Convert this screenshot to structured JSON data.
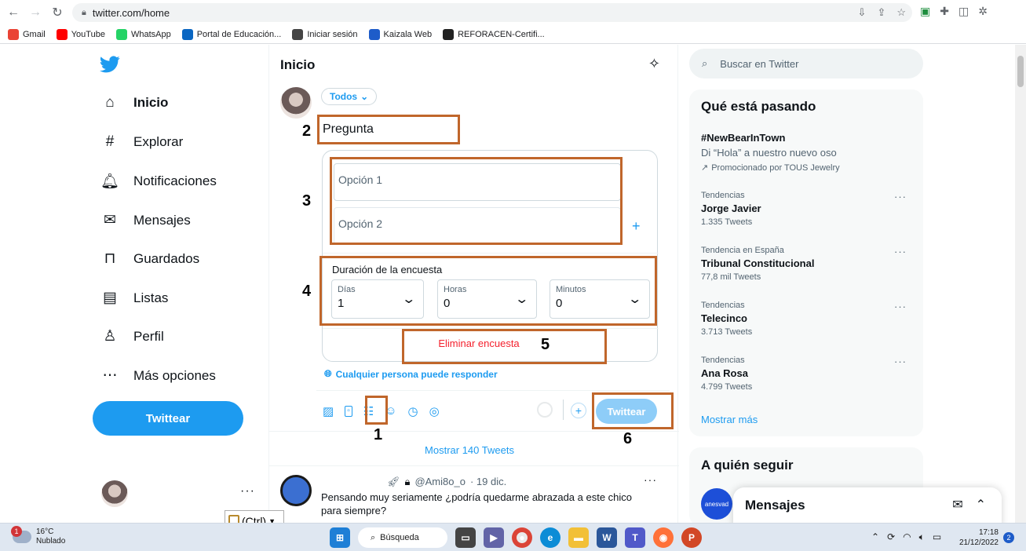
{
  "browser": {
    "url": "twitter.com/home",
    "bookmarks": [
      {
        "label": "Gmail",
        "color": "#ea4335"
      },
      {
        "label": "YouTube",
        "color": "#ff0000"
      },
      {
        "label": "WhatsApp",
        "color": "#25d366"
      },
      {
        "label": "Portal de Educación...",
        "color": "#0a66c2"
      },
      {
        "label": "Iniciar sesión",
        "color": "#444444"
      },
      {
        "label": "Kaizala Web",
        "color": "#1e5cc9"
      },
      {
        "label": "REFORACEN-Certifi...",
        "color": "#222222"
      }
    ]
  },
  "sidebar": {
    "items": [
      {
        "label": "Inicio",
        "icon": "home-icon",
        "glyph": "⌂"
      },
      {
        "label": "Explorar",
        "icon": "hashtag-icon",
        "glyph": "#"
      },
      {
        "label": "Notificaciones",
        "icon": "bell-icon",
        "glyph": "🔔︎"
      },
      {
        "label": "Mensajes",
        "icon": "envelope-icon",
        "glyph": "✉"
      },
      {
        "label": "Guardados",
        "icon": "bookmark-icon",
        "glyph": "⊓"
      },
      {
        "label": "Listas",
        "icon": "list-icon",
        "glyph": "▤"
      },
      {
        "label": "Perfil",
        "icon": "person-icon",
        "glyph": "♙"
      },
      {
        "label": "Más opciones",
        "icon": "more-circle-icon",
        "glyph": "⋯"
      }
    ],
    "tweet_button": "Twittear"
  },
  "main": {
    "title": "Inicio",
    "audience": "Todos",
    "question": "Pregunta",
    "poll": {
      "option1_placeholder": "Opción 1",
      "option2_placeholder": "Opción 2",
      "duration_label": "Duración de la encuesta",
      "days_label": "Días",
      "days_value": "1",
      "hours_label": "Horas",
      "hours_value": "0",
      "minutes_label": "Minutos",
      "minutes_value": "0",
      "remove": "Eliminar encuesta"
    },
    "reply_setting": "Cualquier persona puede responder",
    "submit": "Twittear",
    "show_more": "Mostrar 140 Tweets",
    "tweet": {
      "handle": "@Ami8o_o",
      "date": "· 19 dic.",
      "text": "Pensando muy seriamente ¿podría quedarme abrazada a este chico para siempre?"
    }
  },
  "annotations": [
    "1",
    "2",
    "3",
    "4",
    "5",
    "6"
  ],
  "right": {
    "search_placeholder": "Buscar en Twitter",
    "trends_title": "Qué está pasando",
    "promo": {
      "tag": "#NewBearInTown",
      "desc": "Di “Hola” a nuestro nuevo oso",
      "by": "Promocionado por TOUS Jewelry"
    },
    "trends": [
      {
        "context": "Tendencias",
        "name": "Jorge Javier",
        "count": "1.335 Tweets"
      },
      {
        "context": "Tendencia en España",
        "name": "Tribunal Constitucional",
        "count": "77,8 mil Tweets"
      },
      {
        "context": "Tendencias",
        "name": "Telecinco",
        "count": "3.713 Tweets"
      },
      {
        "context": "Tendencias",
        "name": "Ana Rosa",
        "count": "4.799 Tweets"
      }
    ],
    "show_more": "Mostrar más",
    "follow_title": "A quién seguir",
    "follow_avatar_text": "anesvad",
    "messages_title": "Mensajes"
  },
  "paste_tag": "(Ctrl)",
  "taskbar": {
    "temp": "16°C",
    "weather": "Nublado",
    "weather_badge": "1",
    "search": "Búsqueda",
    "time": "17:18",
    "date": "21/12/2022",
    "notif_count": "2"
  }
}
